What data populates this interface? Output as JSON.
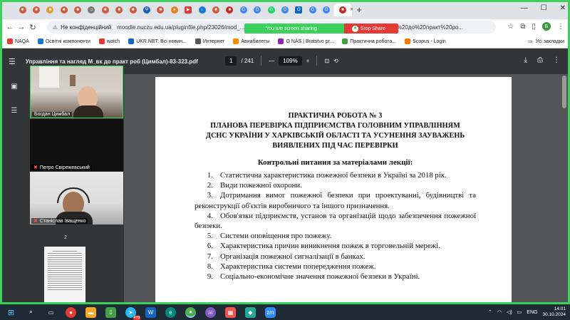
{
  "browser": {
    "tab_count_icons": [
      "doc-icon",
      "doc-icon",
      "doc-icon",
      "doc-icon",
      "doc-icon",
      "home-icon",
      "doc-icon",
      "doc-icon",
      "doc-icon",
      "trident-icon",
      "doc-icon",
      "news-icon",
      "youtube-icon",
      "download-icon",
      "doc-icon",
      "media-icon",
      "translate-icon",
      "google-icon",
      "whatsapp-icon",
      "google-icon",
      "outlook-icon",
      "google-icon",
      "google-icon",
      "active-tab"
    ],
    "omnibox": {
      "insecure_label": "Не конфіденційний",
      "url": "moodle.nuczu.edu.ua/pluginfile.php/23026/mod_...",
      "url_tail": "M_вк%20до%20практ%20ро..."
    },
    "profile_letter": "Б"
  },
  "sharebar": {
    "message": "You are screen sharing",
    "stop_label": "Stop Share"
  },
  "bookmarks": [
    {
      "label": "NAQA",
      "color": "#e53935"
    },
    {
      "label": "Освітні компоненти",
      "color": "#1976d2"
    },
    {
      "label": "watch",
      "color": "#e53935"
    },
    {
      "label": "UKR.NET: Всі новин...",
      "color": "#1565c0"
    },
    {
      "label": "Интернет",
      "color": "#555555"
    },
    {
      "label": "Авиабилеты",
      "color": "#fb8c00"
    },
    {
      "label": "О NÀS | Bratstvo pr...",
      "color": "#8e24aa"
    },
    {
      "label": "Практична робота...",
      "color": "#43a047"
    },
    {
      "label": "Scopus - Login",
      "color": "#f57c00"
    }
  ],
  "bookmarks_all": "Усі закладки",
  "pdf": {
    "title": "Управління та нагляд М_вк до практ роб (Цимбал)-83-323.pdf",
    "page_current": "1",
    "page_total": "/ 241",
    "zoom": "109%"
  },
  "participants": [
    {
      "name": "Богдан Цимбал",
      "muted": false
    },
    {
      "name": "Петро Свірежевський",
      "muted": true
    },
    {
      "name": "Станіслав Іващенко",
      "muted": true
    }
  ],
  "thumb_page_label": "2",
  "document": {
    "heading_lines": [
      "ПРАКТИЧНА РОБОТА № 3",
      "ПЛАНОВА ПЕРЕВІРКА ПІДПРИЄМСТВА ГОЛОВНИМ УПРАВЛІННЯМ",
      "ДСНС УКРАЇНИ У ХАРКІВСЬКІЙ ОБЛАСТІ ТА УСУНЕННЯ ЗАУВАЖЕНЬ",
      "ВИЯВЛЕНИХ ПІД ЧАС ПЕРЕВІРКИ"
    ],
    "subheading": "Контрольні питання за матеріалами лекції:",
    "items": [
      {
        "n": "1.",
        "text": "Статистична характеристика пожежної безпеки в Україні за 2018 рік."
      },
      {
        "n": "2.",
        "text": "Види пожежної охорони."
      },
      {
        "n": "3.",
        "text": "Дотримання вимог пожежної безпеки при проектуванні, будівництві та реконструкції об'єктів виробничого та іншого призначення."
      },
      {
        "n": "4.",
        "text": "Обов'язки підприємств, установ та організацій щодо забезпечення пожежної безпеки."
      },
      {
        "n": "5.",
        "text": "Системи оповіщення  про пожежу."
      },
      {
        "n": "6.",
        "text": "Характеристика причин виникнення пожеж в торговельній мережі."
      },
      {
        "n": "7.",
        "text": "Організація пожежної сигналізації в банках."
      },
      {
        "n": "8.",
        "text": "Характеристика системи попередження пожеж."
      },
      {
        "n": "9.",
        "text": "Соціально-економічне значення пожежної безпеки в Україні."
      }
    ]
  },
  "taskbar": {
    "telegram_badge": "478",
    "lang": "ENG",
    "time": "14:01",
    "date": "30.10.2024"
  }
}
